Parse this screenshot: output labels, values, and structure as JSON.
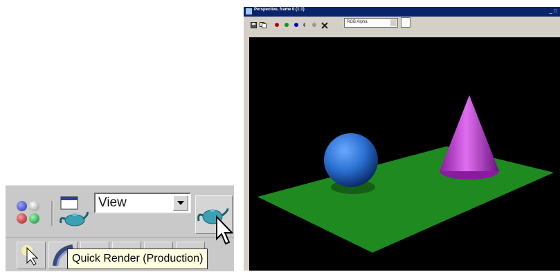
{
  "toolbar": {
    "view_dropdown_value": "View",
    "tooltip": "Quick Render (Production)",
    "buttons": {
      "material_editor_icon": "material-editor-icon",
      "render_scene_icon": "render-scene-dialog-icon",
      "quick_render_icon": "teapot-icon"
    }
  },
  "frame_window": {
    "title": "Perspective, frame 0 (1:1)",
    "title_buttons": "_ □",
    "channel_select_value": "RGB Alpha",
    "channel_dots": [
      "#c00000",
      "#00a000",
      "#0000c0"
    ],
    "icons": [
      "save-icon",
      "clone-icon",
      "red-channel-icon",
      "green-channel-icon",
      "blue-channel-icon",
      "alpha-channel-icon",
      "mono-icon",
      "clear-icon"
    ]
  },
  "scene": {
    "background": "#000000",
    "plane_color": "#1f8a1f",
    "sphere_color": "#2a6fd0",
    "cone_color": "#b030c8"
  }
}
